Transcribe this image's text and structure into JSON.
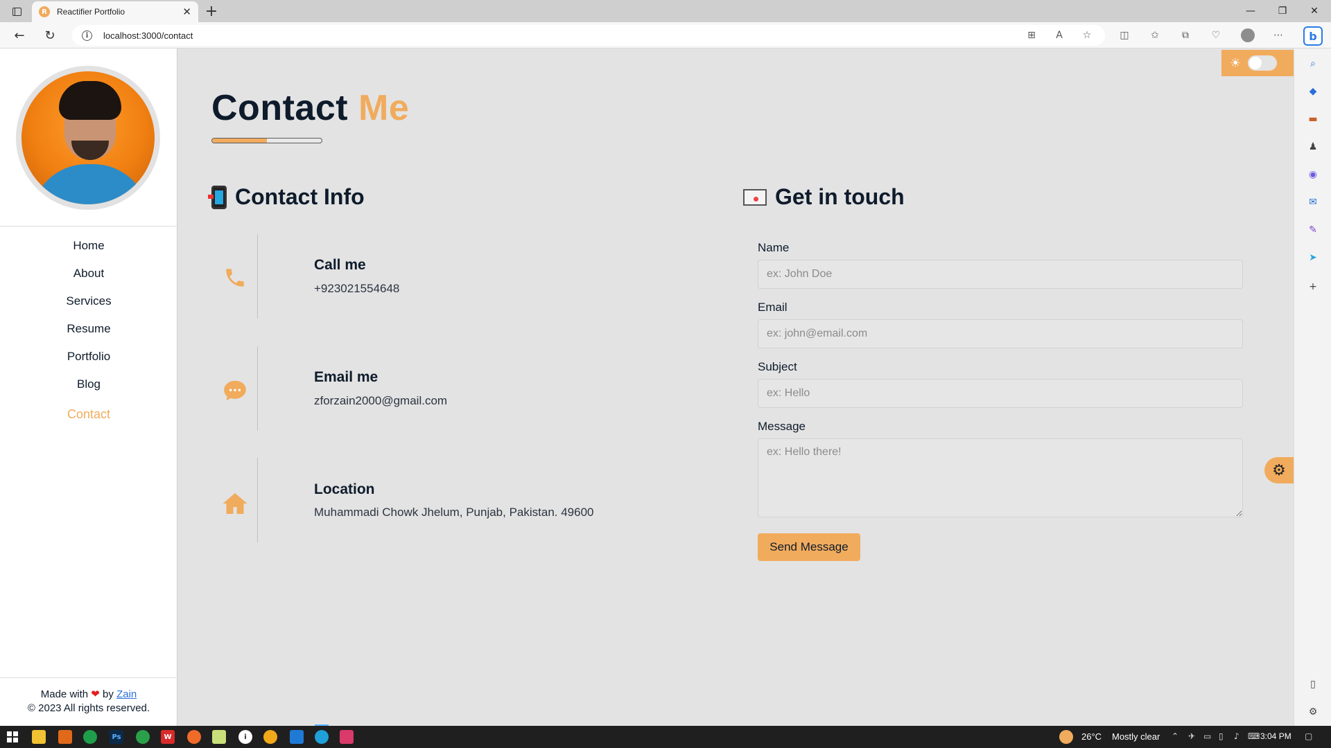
{
  "browser": {
    "tab_title": "Reactifier Portfolio",
    "tab_favicon_letter": "R",
    "tab_close": "✕",
    "new_tab": "+",
    "url": "localhost:3000/contact",
    "window_minimize": "—",
    "window_restore": "❐",
    "window_close": "✕"
  },
  "sidebar": {
    "nav": [
      {
        "label": "Home"
      },
      {
        "label": "About"
      },
      {
        "label": "Services"
      },
      {
        "label": "Resume"
      },
      {
        "label": "Portfolio"
      },
      {
        "label": "Blog"
      },
      {
        "label": "Contact",
        "active": true
      }
    ],
    "footer": {
      "made_with": "Made with",
      "by": "by",
      "author": "Zain",
      "copyright": "© 2023 All rights reserved."
    }
  },
  "page": {
    "title_main": "Contact",
    "title_accent": "Me",
    "title_bar_progress": 0.5
  },
  "contact_info": {
    "heading": "Contact Info",
    "items": [
      {
        "icon": "phone-icon",
        "label": "Call me",
        "value": "+923021554648"
      },
      {
        "icon": "chat-icon",
        "label": "Email me",
        "value": "zforzain2000@gmail.com"
      },
      {
        "icon": "home-icon",
        "label": "Location",
        "value": "Muhammadi Chowk Jhelum, Punjab, Pakistan. 49600"
      }
    ]
  },
  "form": {
    "heading": "Get in touch",
    "name_label": "Name",
    "name_placeholder": "ex: John Doe",
    "email_label": "Email",
    "email_placeholder": "ex: john@email.com",
    "subject_label": "Subject",
    "subject_placeholder": "ex: Hello",
    "message_label": "Message",
    "message_placeholder": "ex: Hello there!",
    "submit_label": "Send Message"
  },
  "theme": {
    "accent": "#f1ab5d",
    "dark_text": "#0e1b2b",
    "background": "#e3e3e3",
    "dark_mode_on": false
  },
  "taskbar": {
    "weather_temp": "26°C",
    "weather_text": "Mostly clear",
    "time": "3:04 PM"
  }
}
